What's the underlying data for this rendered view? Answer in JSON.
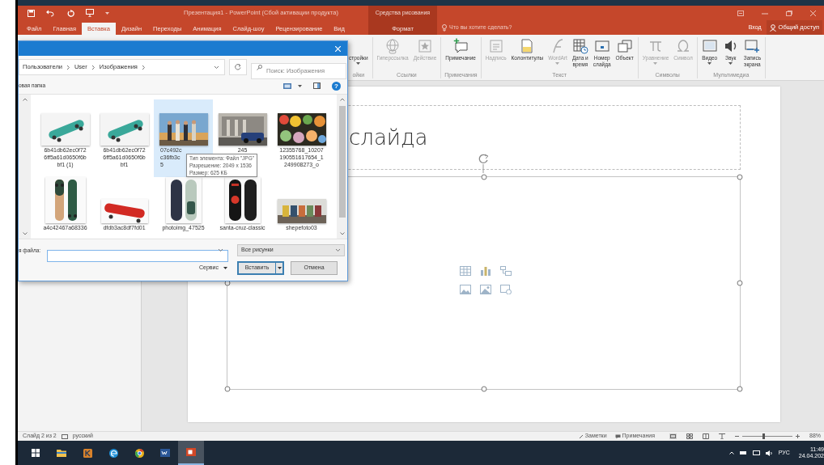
{
  "title_bar": {
    "title": "Презентация1 - PowerPoint (Сбой активации продукта)",
    "context_label": "Средства рисования"
  },
  "tabs": [
    {
      "label": "Файл",
      "selected": false,
      "kind": "normal"
    },
    {
      "label": "Главная",
      "selected": false,
      "kind": "normal"
    },
    {
      "label": "Вставка",
      "selected": true,
      "kind": "normal"
    },
    {
      "label": "Дизайн",
      "selected": false,
      "kind": "normal"
    },
    {
      "label": "Переходы",
      "selected": false,
      "kind": "normal"
    },
    {
      "label": "Анимация",
      "selected": false,
      "kind": "normal"
    },
    {
      "label": "Слайд-шоу",
      "selected": false,
      "kind": "normal"
    },
    {
      "label": "Рецензирование",
      "selected": false,
      "kind": "normal"
    },
    {
      "label": "Вид",
      "selected": false,
      "kind": "normal"
    },
    {
      "label": "Формат",
      "selected": false,
      "kind": "context"
    }
  ],
  "tell_me": {
    "placeholder": "Что вы хотите сделать?"
  },
  "sign_in": "Вход",
  "share": "Общий доступ",
  "ribbon_groups": [
    {
      "label": "ойки",
      "items": [
        {
          "label": "стройки",
          "kind": "none",
          "disabled": false,
          "dropdown": true
        }
      ]
    },
    {
      "label": "Ссылки",
      "items": [
        {
          "label": "Гиперссылка",
          "kind": "globe",
          "disabled": true,
          "dropdown": false
        },
        {
          "label": "Действие",
          "kind": "star",
          "disabled": true,
          "dropdown": false
        }
      ]
    },
    {
      "label": "Примечания",
      "items": [
        {
          "label": "Примечание",
          "kind": "comment",
          "disabled": false,
          "dropdown": false
        }
      ]
    },
    {
      "label": "Текст",
      "items": [
        {
          "label": "Надпись",
          "kind": "textbox",
          "disabled": true,
          "dropdown": false
        },
        {
          "label": "Колонтитулы",
          "kind": "page",
          "disabled": false,
          "dropdown": false
        },
        {
          "label": "WordArt",
          "kind": "curve",
          "disabled": true,
          "dropdown": true
        },
        {
          "label": "Дата и\nвремя",
          "kind": "calendar",
          "disabled": false,
          "dropdown": false
        },
        {
          "label": "Номер\nслайда",
          "kind": "slide-number",
          "disabled": false,
          "dropdown": false
        },
        {
          "label": "Объект",
          "kind": "object",
          "disabled": false,
          "dropdown": false
        }
      ]
    },
    {
      "label": "Символы",
      "items": [
        {
          "label": "Уравнение",
          "kind": "pi",
          "disabled": true,
          "dropdown": true
        },
        {
          "label": "Символ",
          "kind": "omega",
          "disabled": true,
          "dropdown": false
        }
      ]
    },
    {
      "label": "Мультимедиа",
      "items": [
        {
          "label": "Видео",
          "kind": "video",
          "disabled": false,
          "dropdown": true
        },
        {
          "label": "Звук",
          "kind": "speaker",
          "disabled": false,
          "dropdown": true
        },
        {
          "label": "Запись\nэкрана",
          "kind": "record",
          "disabled": false,
          "dropdown": false
        }
      ]
    }
  ],
  "slide": {
    "title": "слайда"
  },
  "dialog": {
    "address": [
      "Пользователи",
      "User",
      "Изображения"
    ],
    "search": {
      "placeholder": "Поиск: Изображения"
    },
    "new_folder": "овая папка",
    "help": "?",
    "files": [
      {
        "name": "6b41db62ec0f72\n6ff5a61d0650f6b\nbf1 (1)",
        "selected": false
      },
      {
        "name": "6b41db62ec0f72\n6ff5a61d0650f6b\nbf1",
        "selected": false
      },
      {
        "name": "07c492c\nc36fb3c\n5",
        "selected": true
      },
      {
        "name": "245",
        "selected": false
      },
      {
        "name": "12355768_10207\n190551617654_1\n249908273_o",
        "selected": false
      },
      {
        "name": "a4c42467a68336",
        "selected": false
      },
      {
        "name": "dfdb3ac8df7fd01",
        "selected": false
      },
      {
        "name": "photoimg_47525",
        "selected": false
      },
      {
        "name": "santa-cruz-classic",
        "selected": false
      },
      {
        "name": "shepefoto03",
        "selected": false
      }
    ],
    "tooltip": [
      "Тип элемента: Файл \"JPG\"",
      "Разрешение: 2049 x 1536",
      "Размер: 625 КБ"
    ],
    "filename_label": "я файла:",
    "filter": "Все рисунки",
    "tools": "Сервис",
    "insert": "Вставить",
    "cancel": "Отмена"
  },
  "status_bar": {
    "slide": "Слайд 2 из 2",
    "language": "русский",
    "notes": "Заметки",
    "comments": "Примечания",
    "zoom": {
      "level": 0.42
    },
    "zoom_text": "88%"
  },
  "taskbar": {
    "apps": [
      {
        "kind": "start",
        "active": false
      },
      {
        "kind": "explorer",
        "active": false
      },
      {
        "kind": "app",
        "active": false
      },
      {
        "kind": "edge",
        "active": false
      },
      {
        "kind": "chrome",
        "active": false
      },
      {
        "kind": "word",
        "active": false
      },
      {
        "kind": "powerpoint",
        "active": true
      }
    ],
    "language": "РУС",
    "time": "11:49",
    "date": "24.04.202"
  }
}
